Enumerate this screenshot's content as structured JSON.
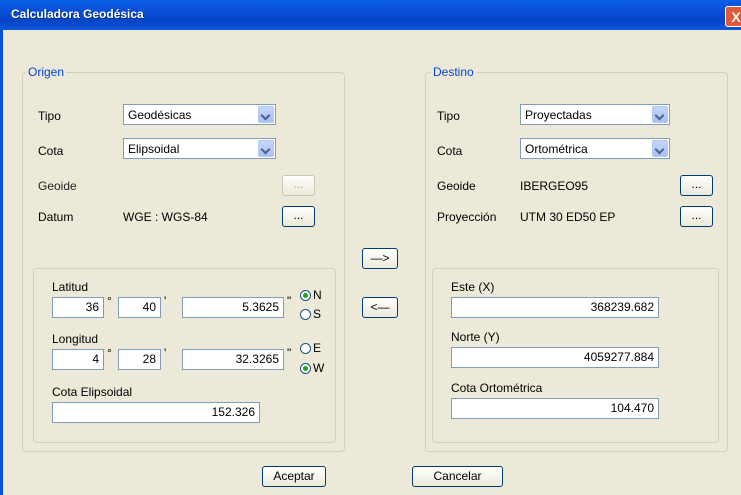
{
  "window": {
    "title": "Calculadora Geodésica",
    "close_label": "X"
  },
  "origen": {
    "legend": "Origen",
    "tipo_label": "Tipo",
    "tipo_value": "Geodésicas",
    "cota_label": "Cota",
    "cota_value": "Elipsoidal",
    "geoide_label": "Geoide",
    "geoide_button": "...",
    "datum_label": "Datum",
    "datum_value": "WGE : WGS-84",
    "datum_button": "...",
    "latitud_label": "Latitud",
    "lat_deg": "36",
    "lat_min": "40",
    "lat_sec": "5.3625",
    "lat_n": "N",
    "lat_s": "S",
    "lat_selected": "N",
    "longitud_label": "Longitud",
    "lon_deg": "4",
    "lon_min": "28",
    "lon_sec": "32.3265",
    "lon_e": "E",
    "lon_w": "W",
    "lon_selected": "W",
    "deg_sym": "°",
    "min_sym": "'",
    "sec_sym": "\"",
    "cota_elip_label": "Cota Elipsoidal",
    "cota_elip_value": "152.326"
  },
  "destino": {
    "legend": "Destino",
    "tipo_label": "Tipo",
    "tipo_value": "Proyectadas",
    "cota_label": "Cota",
    "cota_value": "Ortométrica",
    "geoide_label": "Geoide",
    "geoide_value": "IBERGEO95",
    "geoide_button": "...",
    "proy_label": "Proyección",
    "proy_value": "UTM 30 ED50 EP",
    "proy_button": "...",
    "este_label": "Este (X)",
    "este_value": "368239.682",
    "norte_label": "Norte (Y)",
    "norte_value": "4059277.884",
    "cota_orto_label": "Cota Ortométrica",
    "cota_orto_value": "104.470"
  },
  "arrows": {
    "forward": "—>",
    "back": "<—"
  },
  "footer": {
    "accept": "Aceptar",
    "cancel": "Cancelar"
  }
}
